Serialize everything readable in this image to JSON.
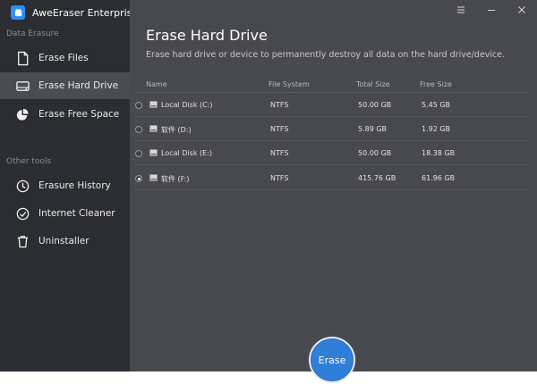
{
  "app": {
    "title": "AweEraser Enterprise"
  },
  "sidebar": {
    "sections": [
      {
        "label": "Data Erasure",
        "items": [
          {
            "label": "Erase Files",
            "icon": "file-icon",
            "active": false
          },
          {
            "label": "Erase Hard Drive",
            "icon": "hard-drive-icon",
            "active": true
          },
          {
            "label": "Erase Free Space",
            "icon": "pie-icon",
            "active": false
          }
        ]
      },
      {
        "label": "Other tools",
        "items": [
          {
            "label": "Erasure History",
            "icon": "history-icon",
            "active": false
          },
          {
            "label": "Internet Cleaner",
            "icon": "internet-icon",
            "active": false
          },
          {
            "label": "Uninstaller",
            "icon": "trash-icon",
            "active": false
          }
        ]
      }
    ]
  },
  "main": {
    "title": "Erase Hard Drive",
    "subtitle": "Erase hard drive or device to permanently destroy all data on the hard drive/device.",
    "columns": {
      "name": "Name",
      "file_system": "File System",
      "total_size": "Total Size",
      "free_size": "Free Size"
    },
    "drives": [
      {
        "name": "Local Disk (C:)",
        "file_system": "NTFS",
        "total_size": "50.00 GB",
        "free_size": "5.45 GB",
        "selected": false
      },
      {
        "name": "软件 (D:)",
        "file_system": "NTFS",
        "total_size": "5.89 GB",
        "free_size": "1.92 GB",
        "selected": false
      },
      {
        "name": "Local Disk (E:)",
        "file_system": "NTFS",
        "total_size": "50.00 GB",
        "free_size": "18.38 GB",
        "selected": false
      },
      {
        "name": "软件 (F:)",
        "file_system": "NTFS",
        "total_size": "415.76 GB",
        "free_size": "61.96 GB",
        "selected": true
      }
    ],
    "erase_button": "Erase"
  },
  "colors": {
    "sidebar_bg": "#2b2d33",
    "main_bg": "#48484f",
    "accent": "#2f7fd9"
  }
}
